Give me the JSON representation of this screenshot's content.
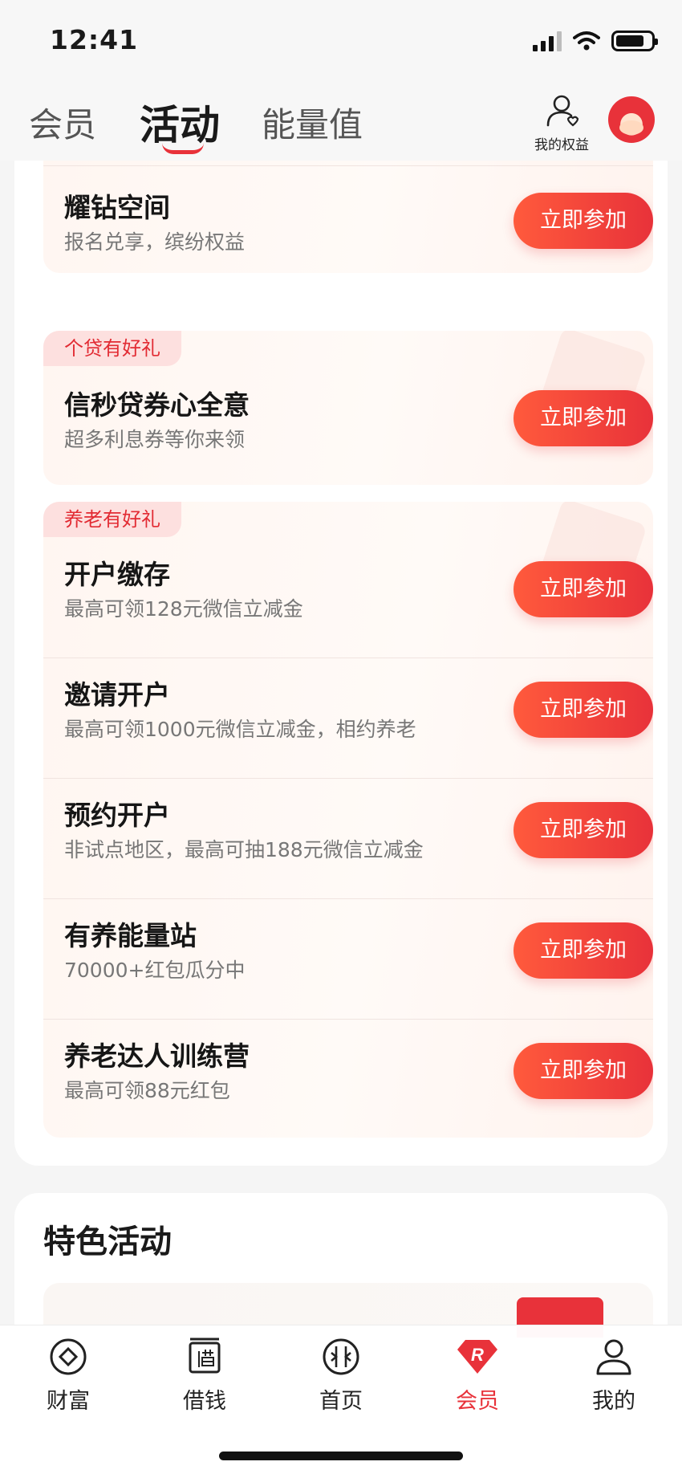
{
  "status": {
    "time": "12:41"
  },
  "tabs": [
    {
      "label": "会员"
    },
    {
      "label": "活动"
    },
    {
      "label": "能量值"
    }
  ],
  "header": {
    "rights_label": "我的权益"
  },
  "sections": [
    {
      "tag": "",
      "items": [
        {
          "title": "耀钻空间",
          "desc": "报名兑享，缤纷权益",
          "button": "立即参加"
        }
      ]
    },
    {
      "tag": "个贷有好礼",
      "items": [
        {
          "title": "信秒贷券心全意",
          "desc": "超多利息券等你来领",
          "button": "立即参加"
        }
      ]
    },
    {
      "tag": "养老有好礼",
      "items": [
        {
          "title": "开户缴存",
          "desc": "最高可领128元微信立减金",
          "button": "立即参加"
        },
        {
          "title": "邀请开户",
          "desc": "最高可领1000元微信立减金，相约养老",
          "button": "立即参加"
        },
        {
          "title": "预约开户",
          "desc": "非试点地区，最高可抽188元微信立减金",
          "button": "立即参加"
        },
        {
          "title": "有养能量站",
          "desc": "70000+红包瓜分中",
          "button": "立即参加"
        },
        {
          "title": "养老达人训练营",
          "desc": "最高可领88元红包",
          "button": "立即参加"
        }
      ]
    }
  ],
  "featured": {
    "title": "特色活动"
  },
  "bottom_nav": [
    {
      "label": "财富",
      "icon": "wealth-icon"
    },
    {
      "label": "借钱",
      "icon": "borrow-icon"
    },
    {
      "label": "首页",
      "icon": "home-icon"
    },
    {
      "label": "会员",
      "icon": "member-icon",
      "active": true
    },
    {
      "label": "我的",
      "icon": "profile-icon"
    }
  ],
  "colors": {
    "accent": "#e8323a",
    "tag_bg": "#fde0df"
  }
}
